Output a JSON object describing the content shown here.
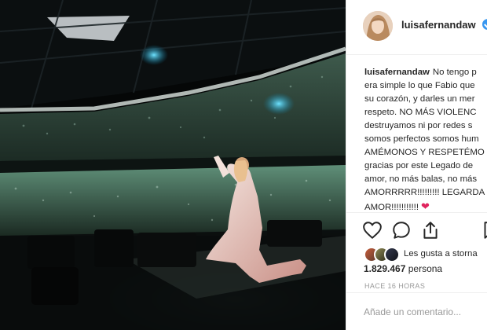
{
  "post": {
    "author": {
      "username": "luisafernandaw",
      "verified": true
    },
    "caption": {
      "username": "luisafernandaw",
      "lines": [
        "No tengo p",
        "era simple lo que Fabio que",
        "su corazón, y darles un mer",
        "respeto. NO MÁS VIOLENC",
        "destruyamos ni por redes s",
        "somos perfectos somos hum",
        "AMÉMONOS Y RESPETÉMO",
        "gracias por este Legado de",
        "amor, no más balas, no más",
        "AMORRRRR!!!!!!!!! LEGARDA",
        "AMOR!!!!!!!!!!!"
      ],
      "emoji": "red-heart"
    },
    "actions": {
      "like_icon": "heart-outline-icon",
      "comment_icon": "speech-bubble-icon",
      "share_icon": "share-upload-icon",
      "bookmark_icon": "bookmark-icon"
    },
    "likes": {
      "liked_by_text": "Les gusta a storna",
      "count": "1.829.467",
      "count_suffix": "persona"
    },
    "timestamp": "HACE 16 HORAS",
    "comment_placeholder": "Añade un comentario..."
  },
  "colors": {
    "verified_badge": "#3897f0",
    "heart": "#e0245e",
    "muted_text": "#999999",
    "divider": "#efefef",
    "photo_background": "#000000"
  }
}
